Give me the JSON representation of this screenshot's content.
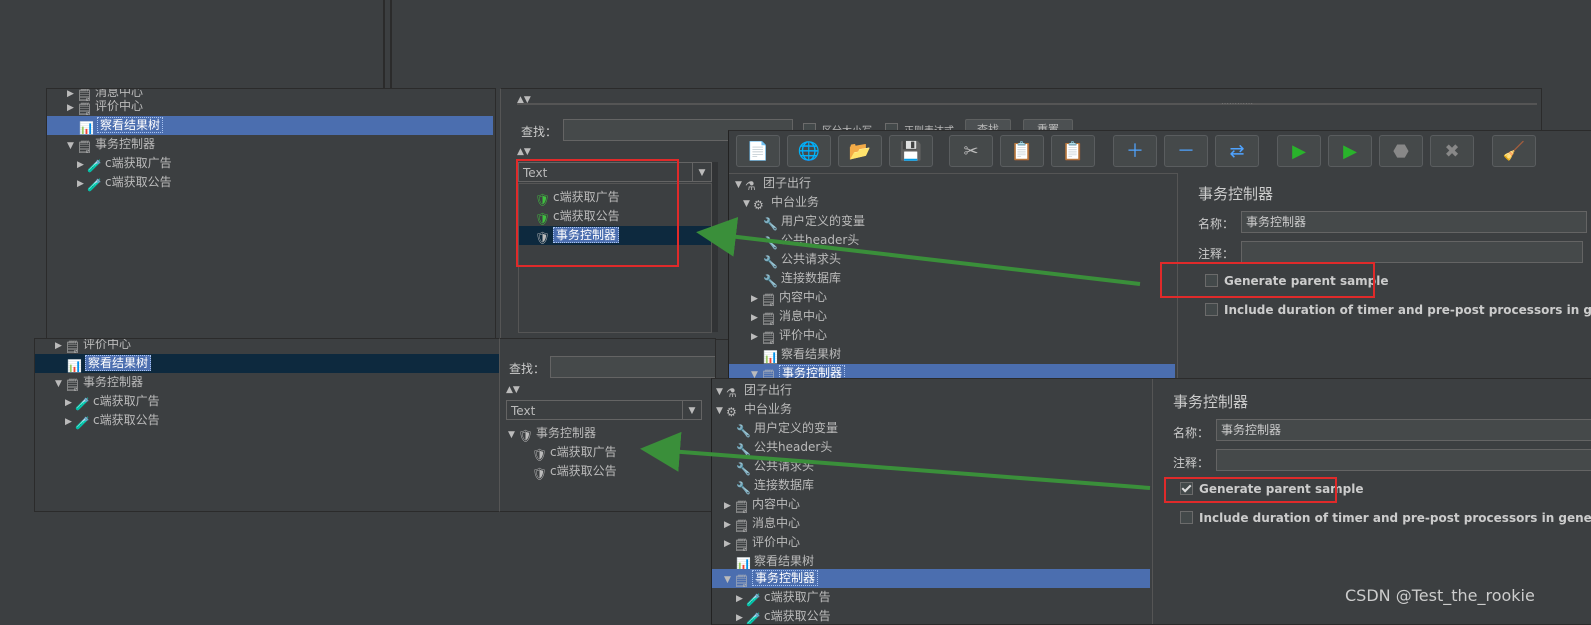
{
  "back_panel": {
    "tree": [
      {
        "label": "消息中心",
        "icon": "controller-icon"
      },
      {
        "label": "评价中心",
        "icon": "controller-icon"
      },
      {
        "label": "察看结果树",
        "icon": "chart-icon"
      },
      {
        "label": "事务控制器",
        "icon": "controller-icon"
      },
      {
        "label": "c端获取广告",
        "icon": "pipette-icon"
      },
      {
        "label": "c端获取公告",
        "icon": "pipette-icon"
      }
    ],
    "search_label": "查找：",
    "case_sensitive": "区分大小写",
    "regex": "正则表达式",
    "find_button": "查找",
    "reset_button": "重置",
    "combo_value": "Text",
    "results": [
      "c端获取广告",
      "c端获取公告",
      "事务控制器"
    ]
  },
  "main_window": {
    "tree": [
      {
        "label": "团子出行"
      },
      {
        "label": "中台业务"
      },
      {
        "label": "用户定义的变量"
      },
      {
        "label": "公共header头"
      },
      {
        "label": "公共请求头"
      },
      {
        "label": "连接数据库"
      },
      {
        "label": "内容中心"
      },
      {
        "label": "消息中心"
      },
      {
        "label": "评价中心"
      },
      {
        "label": "察看结果树"
      },
      {
        "label": "事务控制器"
      }
    ],
    "panel_title": "事务控制器",
    "name_label": "名称：",
    "name_value": "事务控制器",
    "comment_label": "注释：",
    "generate_parent_sample": "Generate parent sample",
    "generate_checked": false,
    "include_duration": "Include duration of timer and pre-post processors in gen"
  },
  "front_panel": {
    "tree": [
      {
        "label": "评价中心"
      },
      {
        "label": "察看结果树"
      },
      {
        "label": "事务控制器"
      },
      {
        "label": "c端获取广告"
      },
      {
        "label": "c端获取公告"
      }
    ],
    "search_label": "查找：",
    "combo_value": "Text",
    "results": [
      "事务控制器",
      "c端获取广告",
      "c端获取公告"
    ]
  },
  "front_window": {
    "tree": [
      {
        "label": "团子出行"
      },
      {
        "label": "中台业务"
      },
      {
        "label": "用户定义的变量"
      },
      {
        "label": "公共header头"
      },
      {
        "label": "公共请求头"
      },
      {
        "label": "连接数据库"
      },
      {
        "label": "内容中心"
      },
      {
        "label": "消息中心"
      },
      {
        "label": "评价中心"
      },
      {
        "label": "察看结果树"
      },
      {
        "label": "事务控制器"
      },
      {
        "label": "c端获取广告"
      },
      {
        "label": "c端获取公告"
      }
    ],
    "panel_title": "事务控制器",
    "name_label": "名称：",
    "name_value": "事务控制器",
    "comment_label": "注释：",
    "generate_parent_sample": "Generate parent sample",
    "generate_checked": true,
    "include_duration": "Include duration of timer and pre-post processors in generated sar"
  },
  "watermark": "CSDN @Test_the_rookie",
  "colors": {
    "background": "#3c3f41",
    "selection": "#4b6eaf",
    "red_box": "#e02a2a",
    "arrow": "#3a8f3a"
  }
}
